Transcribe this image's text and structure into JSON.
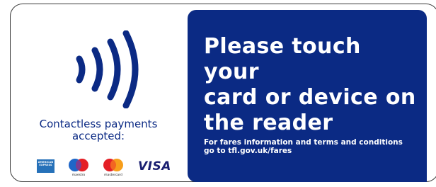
{
  "left_panel": {
    "icon": "contactless-icon",
    "payments_line1": "Contactless payments",
    "payments_line2": "accepted:",
    "cards": {
      "amex_label": "AMERICAN EXPRESS",
      "maestro_label": "maestro",
      "mastercard_label": "mastercard",
      "visa_label": "VISA"
    }
  },
  "right_panel": {
    "headline_line1": "Please touch your",
    "headline_line2": "card or device on",
    "headline_line3": "the reader",
    "fares_line1": "For fares information and terms and conditions",
    "fares_line2": "go to tfl.gov.uk/fares"
  },
  "colors": {
    "brand_blue": "#0b2a84",
    "border": "#3a3a3a",
    "text_on_blue": "#ffffff",
    "maestro_red": "#e41f26",
    "maestro_blue": "#1f66c8",
    "mastercard_red": "#e41f26",
    "mastercard_orange": "#f79e1b",
    "amex_blue": "#2671b9",
    "visa_navy": "#1a1f71"
  }
}
